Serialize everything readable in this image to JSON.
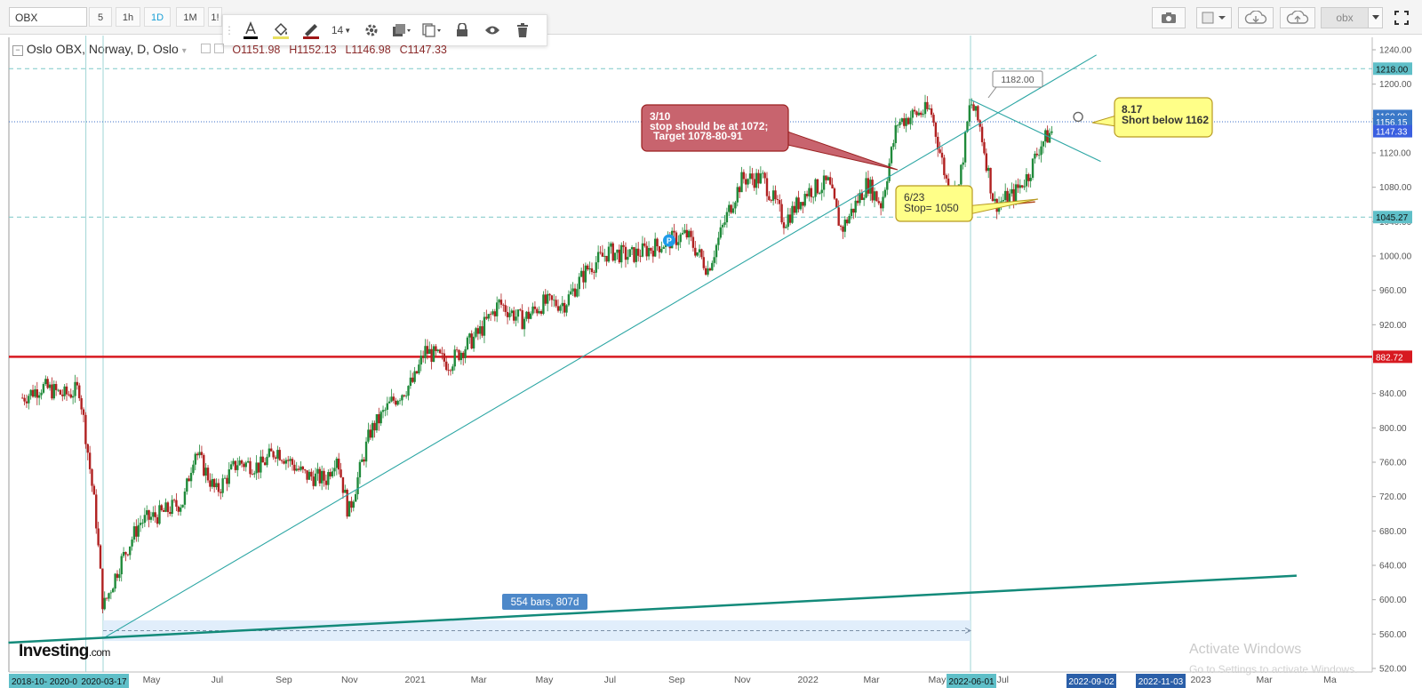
{
  "toolbar": {
    "symbol": "OBX",
    "timeframes": [
      "5",
      "1h",
      "1D",
      "1M",
      "1!"
    ],
    "active_timeframe": "1D",
    "account_label": "obx"
  },
  "draw_toolbar": {
    "font_size": "14",
    "tools": [
      "text-color",
      "fill-color",
      "line-color",
      "font-size",
      "settings",
      "clone",
      "copy",
      "lock",
      "visibility",
      "delete"
    ]
  },
  "legend": {
    "title": "Oslo OBX, Norway, D, Oslo",
    "open": "O1151.98",
    "high": "H1152.13",
    "low": "L1146.98",
    "close": "C1147.33"
  },
  "annotations": {
    "note_red": [
      "3/10",
      "stop should be at 1072;",
      "Target 1078-80-91"
    ],
    "note_yellow_1": [
      "6/23",
      "Stop= 1050"
    ],
    "note_yellow_2": [
      "8.17",
      "Short below 1162"
    ],
    "peak_label": "1182.00",
    "range_label": "554 bars, 807d"
  },
  "price_badges": {
    "resistance": "1218.00",
    "upper_1": "1160.90",
    "upper_2": "1156.15",
    "last": "1147.33",
    "support": "1045.27",
    "red_line": "882.72"
  },
  "time_badges": {
    "left_cut": "2018-10- 2020-0",
    "start": "2020-03-17",
    "vline": "2022-06-01",
    "future_1": "2022-09-02",
    "future_2": "2022-11-03"
  },
  "watermark": {
    "line1": "Activate Windows",
    "line2": "Go to Settings to activate Windows."
  },
  "branding": {
    "logo": "Investing",
    "logo_suffix": ".com"
  },
  "colors": {
    "up": "#1f8a3a",
    "down": "#b02020",
    "trend": "#2ca6a4",
    "red_line": "#d71920",
    "badge_blue": "#3a78c8",
    "badge_dark": "#2b5fa8",
    "badge_teal": "#5fbfc8",
    "note_red": "#c8646e",
    "note_yellow": "#ffff88"
  },
  "chart_data": {
    "type": "candlestick",
    "title": "Oslo OBX, Norway, D, Oslo",
    "ylim": [
      520,
      1240
    ],
    "y_ticks": [
      "1240.00",
      "1200.00",
      "1160.00",
      "1120.00",
      "1080.00",
      "1040.00",
      "1000.00",
      "960.00",
      "920.00",
      "880.00",
      "840.00",
      "800.00",
      "760.00",
      "720.00",
      "680.00",
      "640.00",
      "600.00",
      "560.00",
      "520.00"
    ],
    "x_ticks": [
      "May",
      "Jul",
      "Sep",
      "Nov",
      "2021",
      "Mar",
      "May",
      "Jul",
      "Sep",
      "Nov",
      "2022",
      "Mar",
      "May",
      "Jul",
      "2023",
      "Mar",
      "Ma"
    ],
    "close_path": [
      {
        "date": "2020-01-02",
        "close": 835
      },
      {
        "date": "2020-01-20",
        "close": 848
      },
      {
        "date": "2020-02-10",
        "close": 838
      },
      {
        "date": "2020-02-24",
        "close": 845
      },
      {
        "date": "2020-03-01",
        "close": 790
      },
      {
        "date": "2020-03-10",
        "close": 700
      },
      {
        "date": "2020-03-17",
        "close": 590
      },
      {
        "date": "2020-04-01",
        "close": 640
      },
      {
        "date": "2020-04-20",
        "close": 690
      },
      {
        "date": "2020-05-10",
        "close": 700
      },
      {
        "date": "2020-05-31",
        "close": 715
      },
      {
        "date": "2020-06-10",
        "close": 775
      },
      {
        "date": "2020-06-30",
        "close": 725
      },
      {
        "date": "2020-07-20",
        "close": 760
      },
      {
        "date": "2020-08-10",
        "close": 755
      },
      {
        "date": "2020-08-25",
        "close": 775
      },
      {
        "date": "2020-09-20",
        "close": 745
      },
      {
        "date": "2020-10-10",
        "close": 740
      },
      {
        "date": "2020-10-20",
        "close": 770
      },
      {
        "date": "2020-10-31",
        "close": 700
      },
      {
        "date": "2020-11-20",
        "close": 795
      },
      {
        "date": "2020-12-10",
        "close": 830
      },
      {
        "date": "2020-12-31",
        "close": 855
      },
      {
        "date": "2021-01-10",
        "close": 890
      },
      {
        "date": "2021-02-01",
        "close": 875
      },
      {
        "date": "2021-03-01",
        "close": 910
      },
      {
        "date": "2021-03-20",
        "close": 945
      },
      {
        "date": "2021-04-10",
        "close": 925
      },
      {
        "date": "2021-04-30",
        "close": 945
      },
      {
        "date": "2021-05-20",
        "close": 945
      },
      {
        "date": "2021-06-10",
        "close": 985
      },
      {
        "date": "2021-06-30",
        "close": 1005
      },
      {
        "date": "2021-07-20",
        "close": 1000
      },
      {
        "date": "2021-08-20",
        "close": 1015
      },
      {
        "date": "2021-09-10",
        "close": 1025
      },
      {
        "date": "2021-09-30",
        "close": 985
      },
      {
        "date": "2021-10-20",
        "close": 1055
      },
      {
        "date": "2021-11-01",
        "close": 1090
      },
      {
        "date": "2021-11-20",
        "close": 1090
      },
      {
        "date": "2021-12-10",
        "close": 1040
      },
      {
        "date": "2021-12-31",
        "close": 1075
      },
      {
        "date": "2022-01-20",
        "close": 1085
      },
      {
        "date": "2022-02-01",
        "close": 1030
      },
      {
        "date": "2022-02-25",
        "close": 1085
      },
      {
        "date": "2022-03-10",
        "close": 1060
      },
      {
        "date": "2022-03-25",
        "close": 1155
      },
      {
        "date": "2022-04-10",
        "close": 1165
      },
      {
        "date": "2022-04-25",
        "close": 1170
      },
      {
        "date": "2022-05-10",
        "close": 1085
      },
      {
        "date": "2022-05-20",
        "close": 1070
      },
      {
        "date": "2022-06-01",
        "close": 1180
      },
      {
        "date": "2022-06-10",
        "close": 1150
      },
      {
        "date": "2022-06-20",
        "close": 1080
      },
      {
        "date": "2022-06-23",
        "close": 1060
      },
      {
        "date": "2022-07-10",
        "close": 1070
      },
      {
        "date": "2022-07-25",
        "close": 1095
      },
      {
        "date": "2022-08-05",
        "close": 1130
      },
      {
        "date": "2022-08-17",
        "close": 1147.33
      }
    ],
    "horizontal_lines": [
      {
        "price": 1218.0,
        "style": "dashed"
      },
      {
        "price": 1156.15,
        "style": "dotted"
      },
      {
        "price": 1045.27,
        "style": "dashed"
      },
      {
        "price": 882.72,
        "style": "solid-red"
      }
    ],
    "trendlines": [
      {
        "from": {
          "date": "2020-03-17",
          "price": 555
        },
        "to": {
          "date": "2022-09-26",
          "price": 1234
        }
      },
      {
        "from": {
          "date": "2022-06-01",
          "price": 1182
        },
        "to": {
          "date": "2022-09-30",
          "price": 1110
        }
      },
      {
        "from": {
          "date": "2019-12-20",
          "price": 550
        },
        "to": {
          "date": "2023-03-31",
          "price": 628
        }
      }
    ]
  }
}
